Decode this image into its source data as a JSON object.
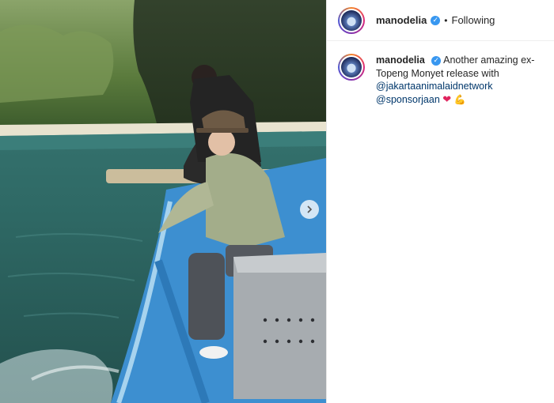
{
  "post": {
    "username": "manodelia",
    "separator": "•",
    "follow_status": "Following",
    "caption": {
      "username": "manodelia",
      "text": "Another amazing ex-Topeng Monyet release with",
      "mentions": [
        "@jakartaanimalaidnetwork",
        "@sponsorjaan"
      ],
      "emojis": [
        "❤",
        "💪"
      ]
    }
  },
  "icons": {
    "verified": "verified-badge-icon",
    "next": "chevron-right-icon"
  },
  "colors": {
    "verified_blue": "#3897f0",
    "mention_blue": "#00376b",
    "heart_red": "#e0245e"
  }
}
